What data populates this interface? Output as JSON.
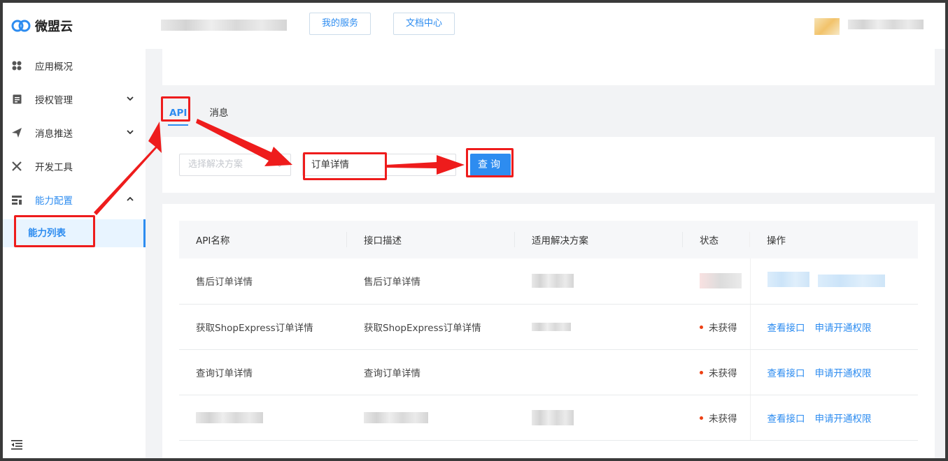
{
  "app": {
    "name": "微盟云"
  },
  "header": {
    "my_services": "我的服务",
    "docs_center": "文档中心"
  },
  "sidebar": {
    "items": [
      {
        "label": "应用概况",
        "icon": "grid-icon"
      },
      {
        "label": "授权管理",
        "icon": "document-icon",
        "expandable": true
      },
      {
        "label": "消息推送",
        "icon": "paper-plane-icon",
        "expandable": true
      },
      {
        "label": "开发工具",
        "icon": "tools-icon"
      },
      {
        "label": "能力配置",
        "icon": "config-icon",
        "expandable": true,
        "expanded": true,
        "active": true
      }
    ],
    "sub_item": "能力列表",
    "collapse_icon": "menu-collapse-icon"
  },
  "tabs": [
    {
      "label": "API",
      "active": true
    },
    {
      "label": "消息",
      "active": false
    }
  ],
  "filter": {
    "solution_placeholder": "选择解决方案",
    "search_value": "订单详情",
    "query_button": "查询"
  },
  "table": {
    "columns": [
      "API名称",
      "接口描述",
      "适用解决方案",
      "状态",
      "操作"
    ],
    "rows": [
      {
        "name": "售后订单详情",
        "desc": "售后订单详情",
        "status": "",
        "view": "",
        "apply": ""
      },
      {
        "name": "获取ShopExpress订单详情",
        "desc": "获取ShopExpress订单详情",
        "status": "未获得",
        "view": "查看接口",
        "apply": "申请开通权限"
      },
      {
        "name": "查询订单详情",
        "desc": "查询订单详情",
        "status": "未获得",
        "view": "查看接口",
        "apply": "申请开通权限"
      },
      {
        "name": "",
        "desc": "",
        "status": "未获得",
        "view": "查看接口",
        "apply": "申请开通权限"
      }
    ]
  },
  "colors": {
    "accent": "#2d8cf0",
    "status_dot": "#ed4014",
    "annotation": "#ee1c1c"
  }
}
